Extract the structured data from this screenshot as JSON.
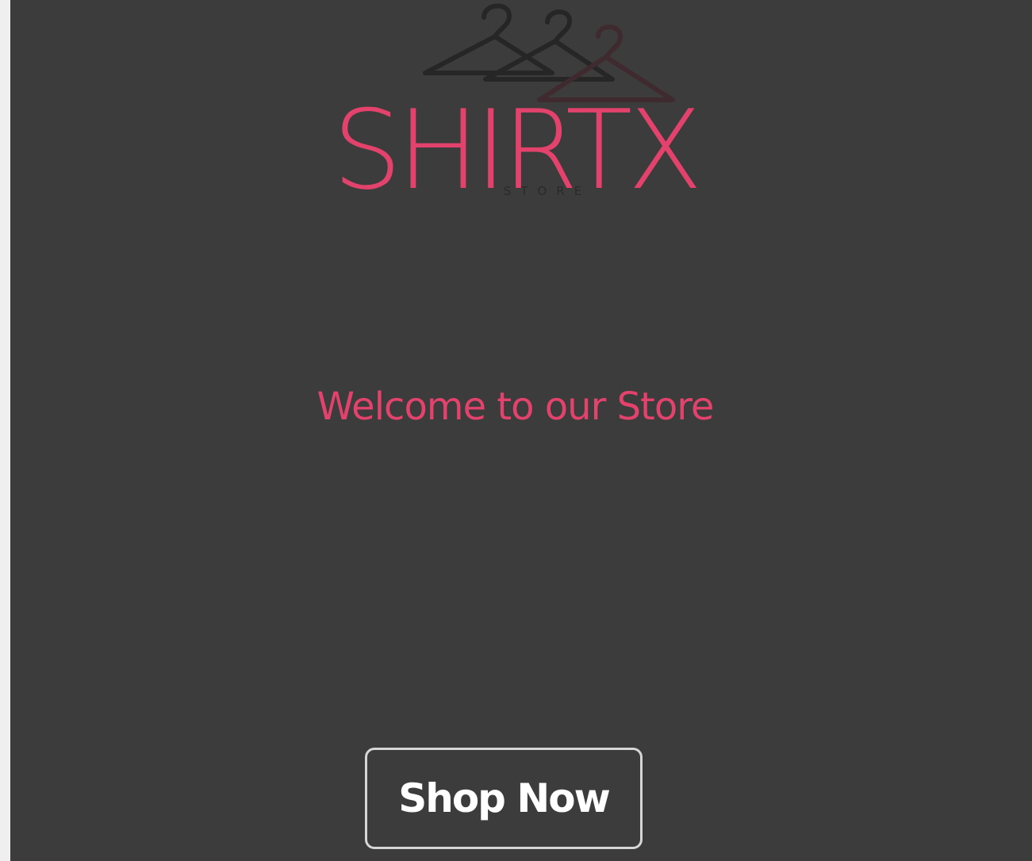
{
  "brand": {
    "name": "SHIRTX",
    "logo_caption": "STORE"
  },
  "hero": {
    "welcome_text": "Welcome to our Store",
    "cta_label": "Shop Now"
  },
  "colors": {
    "background": "#3c3c3c",
    "accent": "#e2426c",
    "button_border": "#d6d6d6",
    "button_text": "#ffffff",
    "page_edge": "#efefef"
  },
  "icons": [
    "hanger-icon"
  ]
}
